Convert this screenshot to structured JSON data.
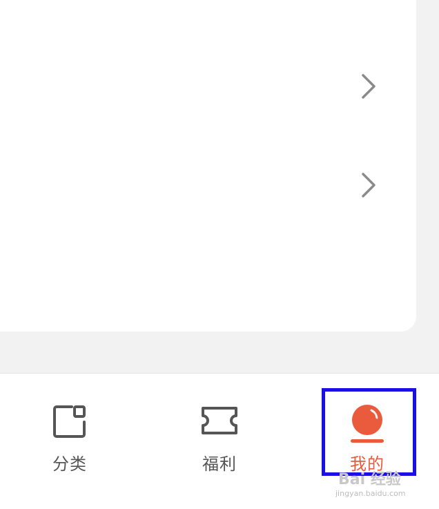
{
  "colors": {
    "accent": "#ea5a3d",
    "highlight": "#1a10e6",
    "text_muted": "#555555"
  },
  "list": {
    "rows": [
      {
        "icon": "chevron-right-icon"
      },
      {
        "icon": "chevron-right-icon"
      }
    ]
  },
  "tabbar": {
    "tabs": [
      {
        "label": "分类",
        "icon": "category-icon",
        "active": false
      },
      {
        "label": "福利",
        "icon": "ticket-icon",
        "active": false
      },
      {
        "label": "我的",
        "icon": "profile-orb-icon",
        "active": true
      }
    ]
  },
  "watermark": {
    "text": "Bai 经验",
    "url": "jingyan.baidu.com"
  }
}
